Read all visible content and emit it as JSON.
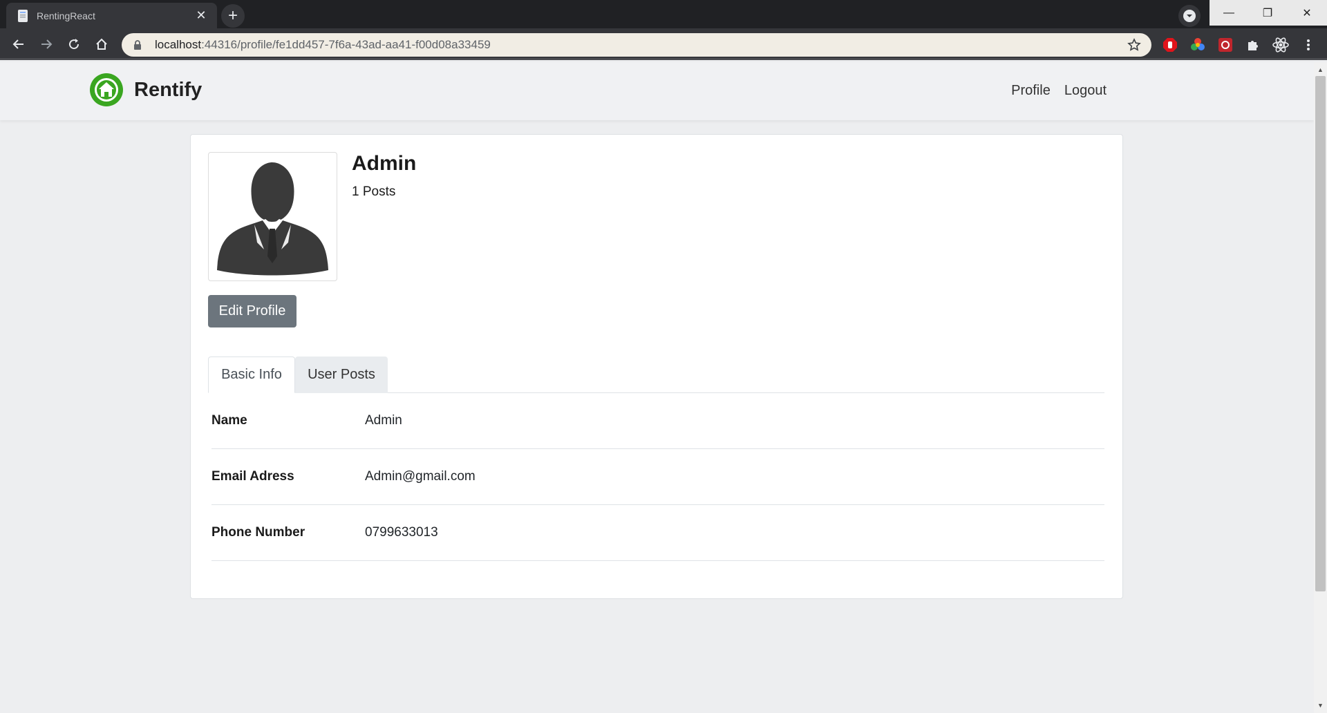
{
  "browser": {
    "tab_title": "RentingReact",
    "tab_close": "✕",
    "new_tab": "+",
    "url_host": "localhost",
    "url_path": ":44316/profile/fe1dd457-7f6a-43ad-aa41-f00d08a33459",
    "window_min": "—",
    "window_max": "❐",
    "window_close": "✕"
  },
  "navbar": {
    "brand": "Rentify",
    "links": {
      "profile": "Profile",
      "logout": "Logout"
    }
  },
  "profile": {
    "name": "Admin",
    "posts": "1 Posts",
    "edit_button": "Edit Profile",
    "tabs": {
      "basic_info": "Basic Info",
      "user_posts": "User Posts"
    },
    "fields": [
      {
        "label": "Name",
        "value": "Admin"
      },
      {
        "label": "Email Adress",
        "value": "Admin@gmail.com"
      },
      {
        "label": "Phone Number",
        "value": "0799633013"
      }
    ]
  },
  "colors": {
    "brand_green": "#3aa620",
    "button_gray": "#6c757d",
    "chrome_dark": "#202124"
  }
}
